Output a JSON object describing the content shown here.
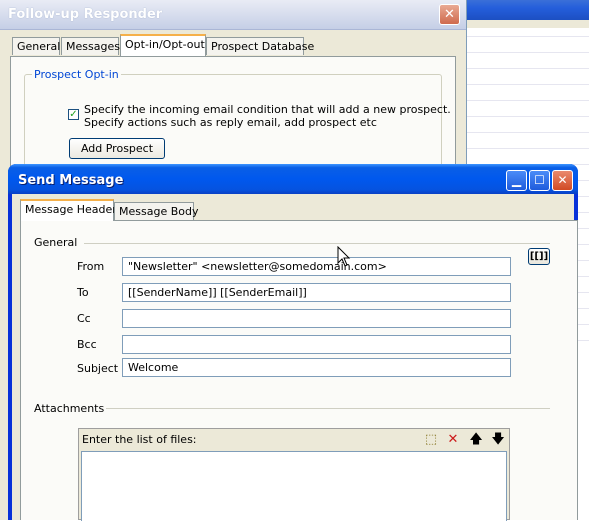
{
  "background_window": {
    "rows": 20
  },
  "follow_up": {
    "title": "Follow-up Responder",
    "close_glyph": "✕",
    "tabs": [
      {
        "label": "General"
      },
      {
        "label": "Messages"
      },
      {
        "label": "Opt-in/Opt-out"
      },
      {
        "label": "Prospect Database"
      }
    ],
    "active_tab": "Opt-in/Opt-out",
    "group_title": "Prospect Opt-in",
    "checkbox_checked": true,
    "checkbox_line1": "Specify the incoming email condition that will add a new prospect.",
    "checkbox_line2": "Specify actions such as reply email, add prospect etc",
    "add_button": "Add Prospect"
  },
  "send_message": {
    "title": "Send Message",
    "tabs": [
      {
        "label": "Message Header"
      },
      {
        "label": "Message Body"
      }
    ],
    "active_tab": "Message Header",
    "general_label": "General",
    "variables_button": "[[]]",
    "fields": {
      "from": {
        "label": "From",
        "value": "\"Newsletter\" <newsletter@somedomain.com>"
      },
      "to": {
        "label": "To",
        "value": "[[SenderName]] [[SenderEmail]]"
      },
      "cc": {
        "label": "Cc",
        "value": ""
      },
      "bcc": {
        "label": "Bcc",
        "value": ""
      },
      "subject": {
        "label": "Subject",
        "value": "Welcome"
      }
    },
    "attachments_label": "Attachments",
    "files_header": "Enter the list of files:",
    "file_tool_icons": [
      "new-file-icon",
      "delete-icon",
      "move-up-icon",
      "move-down-icon"
    ]
  }
}
